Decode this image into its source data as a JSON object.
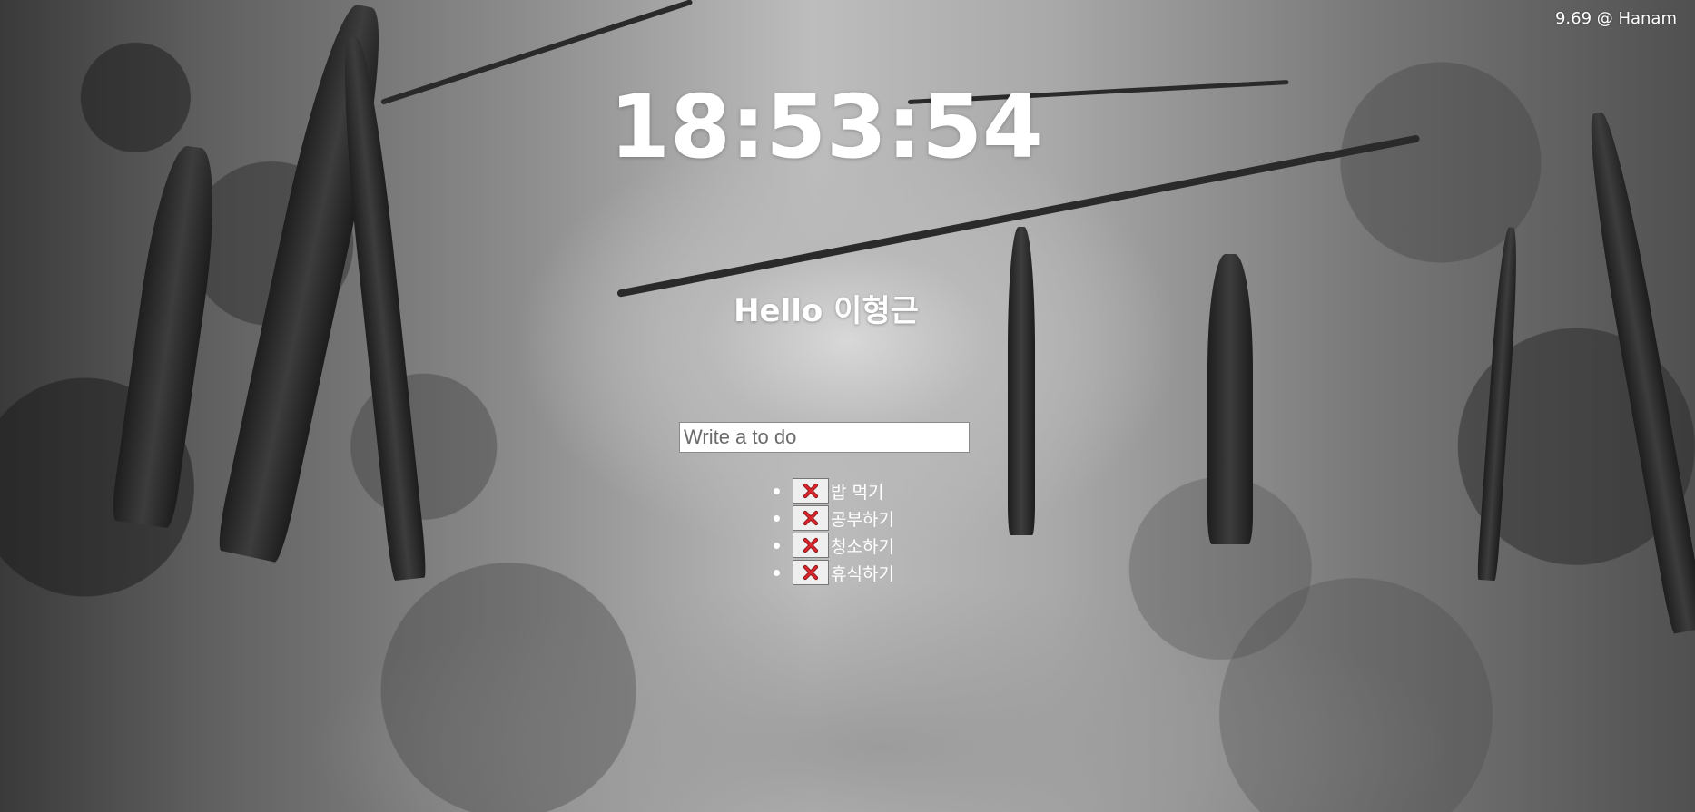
{
  "weather": {
    "text": "9.69 @ Hanam"
  },
  "clock": {
    "time": "18:53:54"
  },
  "greeting": {
    "text": "Hello 이형근"
  },
  "todo": {
    "placeholder": "Write a to do",
    "value": "",
    "delete_icon": "red-x-icon",
    "items": [
      {
        "text": "밥 먹기"
      },
      {
        "text": "공부하기"
      },
      {
        "text": "청소하기"
      },
      {
        "text": "휴식하기"
      }
    ]
  },
  "colors": {
    "text": "#ffffff",
    "delete_x": "#d8262c",
    "button_bg": "#efefef"
  }
}
